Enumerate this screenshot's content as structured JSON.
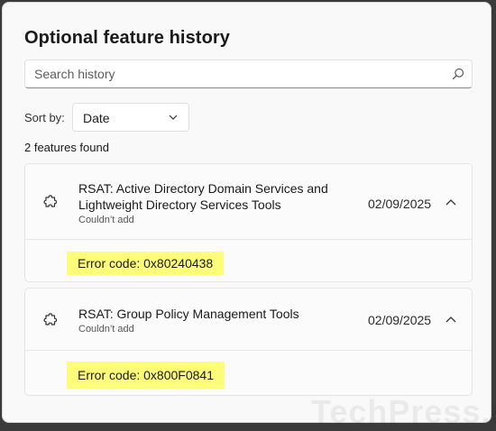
{
  "dialog": {
    "title": "Optional feature history",
    "search": {
      "placeholder": "Search history",
      "value": ""
    },
    "sort": {
      "label": "Sort by:",
      "selected": "Date"
    },
    "count_text": "2 features found",
    "features": [
      {
        "name": "RSAT: Active Directory Domain Services and Lightweight Directory Services Tools",
        "status": "Couldn’t add",
        "date": "02/09/2025",
        "error": "Error code: 0x80240438",
        "expanded": true
      },
      {
        "name": "RSAT: Group Policy Management Tools",
        "status": "Couldn’t add",
        "date": "02/09/2025",
        "error": "Error code: 0x800F0841",
        "expanded": true
      }
    ]
  },
  "highlight_color": "#fdfd7a",
  "watermark": "TechPress.net",
  "icons": {
    "search": "search-icon",
    "chevron": "chevron-down-icon",
    "feature": "puzzle-icon",
    "collapse": "chevron-up-icon"
  }
}
